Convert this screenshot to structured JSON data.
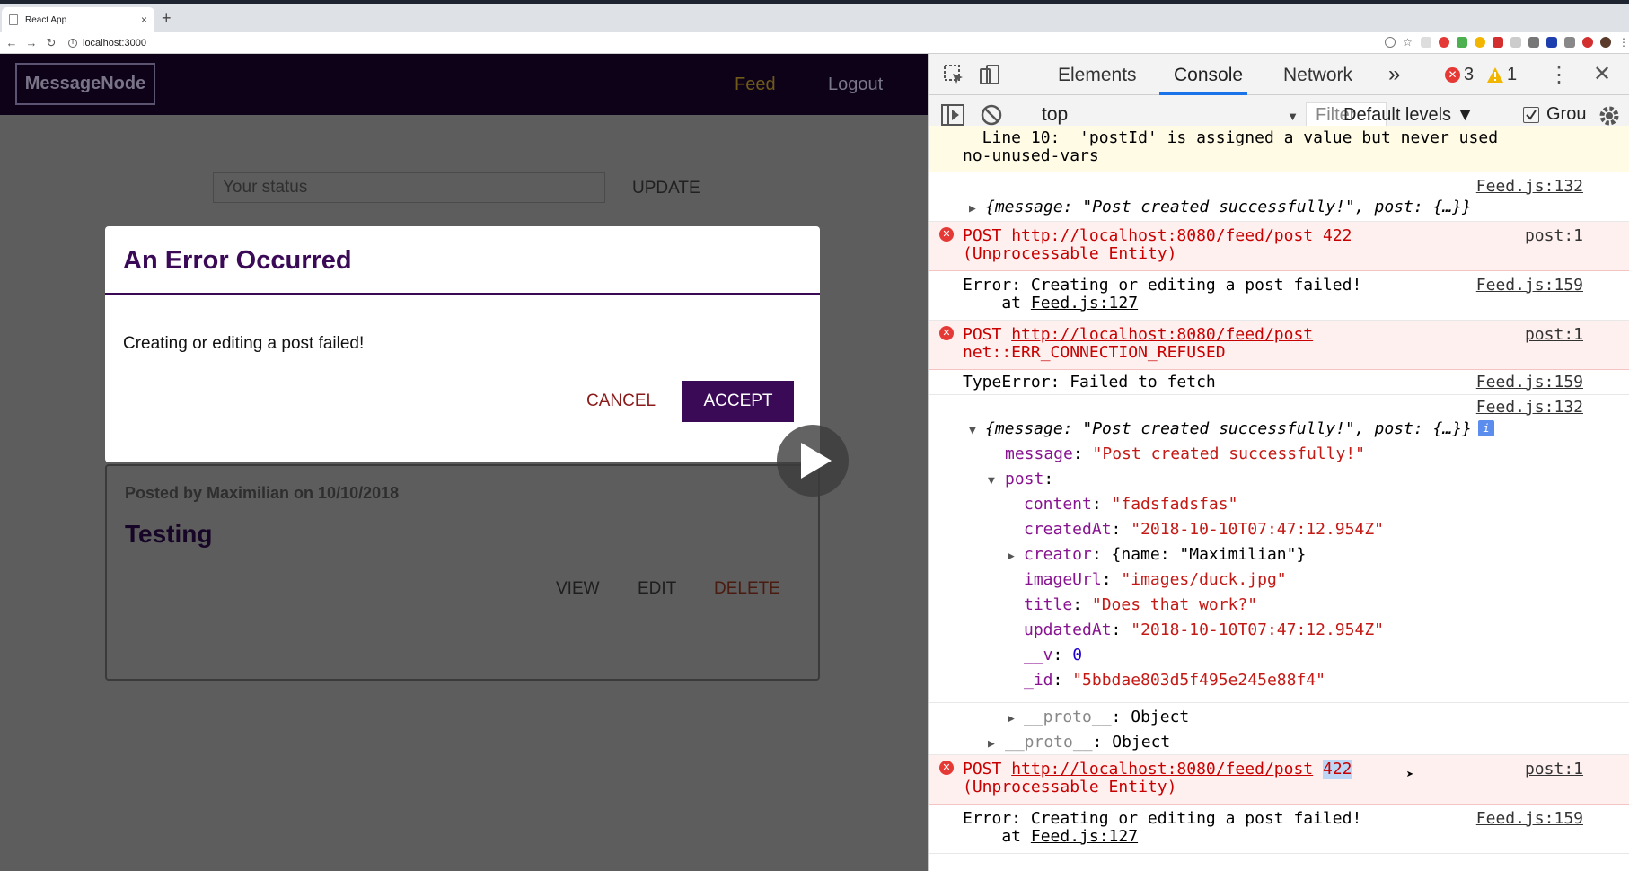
{
  "browser": {
    "tab_title": "React App",
    "tab_close": "×",
    "new_tab": "+",
    "url": "localhost:3000"
  },
  "app": {
    "logo": "MessageNode",
    "nav": {
      "feed": "Feed",
      "logout": "Logout"
    },
    "status_placeholder": "Your status",
    "update_label": "UPDATE",
    "post": {
      "meta": "Posted by Maximilian on 10/10/2018",
      "title": "Testing",
      "view": "VIEW",
      "edit": "EDIT",
      "delete": "DELETE"
    },
    "modal": {
      "title": "An Error Occurred",
      "message": "Creating or editing a post failed!",
      "cancel": "CANCEL",
      "accept": "ACCEPT"
    }
  },
  "devtools": {
    "tabs": [
      "Elements",
      "Console",
      "Network"
    ],
    "more": "»",
    "errors": "3",
    "warnings": "1",
    "context": "top",
    "filter": "Filter",
    "levels": "Default levels ▼",
    "group": "Grou",
    "console": {
      "warn_line1": "  Line 10:  'postId' is assigned a value but never used",
      "warn_line2": "no-unused-vars",
      "log1_src": "Feed.js:132",
      "log1_text": "{message: \"Post created successfully!\", post: {…}}",
      "err1_method": "POST ",
      "err1_url": "http://localhost:8080/feed/post",
      "err1_status": " 422",
      "err1_status2": "(Unprocessable Entity)",
      "err1_src": "post:1",
      "err2_line1": "Error: Creating or editing a post failed!",
      "err2_at": "    at ",
      "err2_loc": "Feed.js:127",
      "err2_src": "Feed.js:159",
      "err3_method": "POST ",
      "err3_url": "http://localhost:8080/feed/post",
      "err3_line2": "net::ERR_CONNECTION_REFUSED",
      "err3_src": "post:1",
      "type_err": "TypeError: Failed to fetch",
      "type_err_src": "Feed.js:159",
      "log2_src": "Feed.js:132",
      "log2_text": "{message: \"Post created successfully!\", post: {…}}",
      "obj": {
        "message_key": "message",
        "message_val": "\"Post created successfully!\"",
        "post_key": "post",
        "content_key": "content",
        "content_val": "\"fadsfadsfas\"",
        "createdAt_key": "createdAt",
        "createdAt_val": "\"2018-10-10T07:47:12.954Z\"",
        "creator_key": "creator",
        "creator_val": "{name: \"Maximilian\"}",
        "imageUrl_key": "imageUrl",
        "imageUrl_val": "\"images/duck.jpg\"",
        "title_key": "title",
        "title_val": "\"Does that work?\"",
        "updatedAt_key": "updatedAt",
        "updatedAt_val": "\"2018-10-10T07:47:12.954Z\"",
        "v_key": "__v",
        "v_val": "0",
        "id_key": "_id",
        "id_val": "\"5bbdae803d5f495e245e88f4\"",
        "proto_key": "__proto__",
        "proto_val": "Object"
      },
      "err4_method": "POST ",
      "err4_url": "http://localhost:8080/feed/post",
      "err4_status": "422",
      "err4_status2": "(Unprocessable Entity)",
      "err4_src": "post:1",
      "err5_line1": "Error: Creating or editing a post failed!",
      "err5_at": "    at ",
      "err5_loc": "Feed.js:127",
      "err5_src": "Feed.js:159"
    }
  },
  "colors": {
    "brand": "#3b0a57",
    "error": "#e53935",
    "warning": "#f2b600"
  }
}
